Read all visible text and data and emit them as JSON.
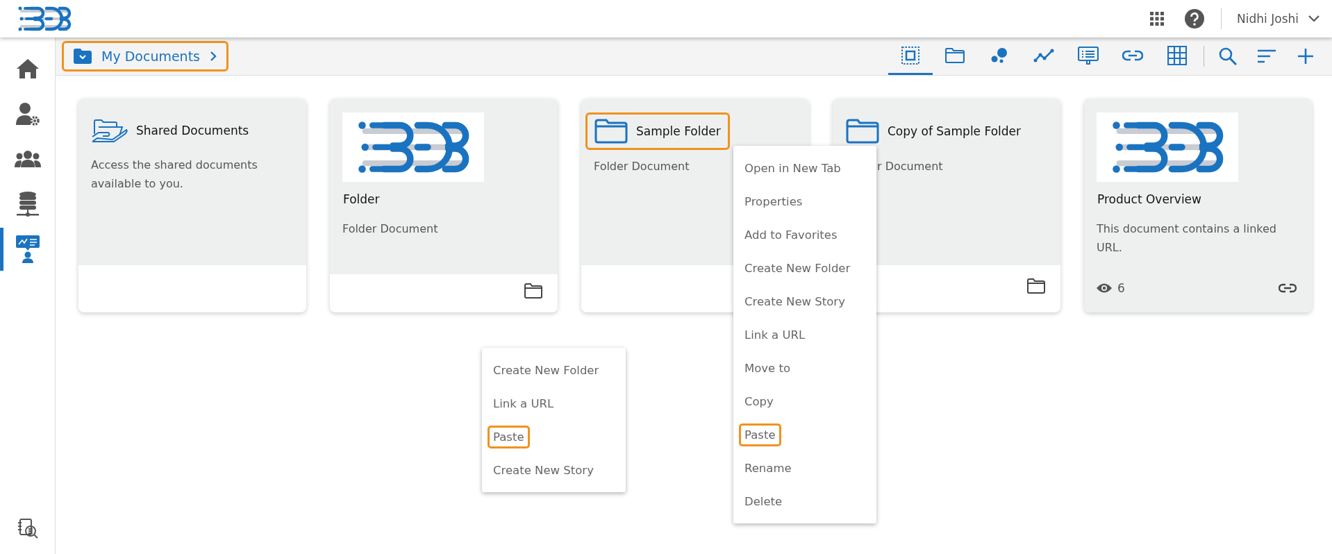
{
  "header": {
    "user_name": "Nidhi Joshi"
  },
  "sidebar": {
    "items": [
      {
        "kind": "home",
        "selected": false
      },
      {
        "kind": "user-settings",
        "selected": false
      },
      {
        "kind": "group",
        "selected": false
      },
      {
        "kind": "database",
        "selected": false
      },
      {
        "kind": "story",
        "selected": true
      }
    ],
    "bottom_item": {
      "kind": "data-search"
    }
  },
  "breadcrumb": {
    "label": "My Documents",
    "highlighted": true
  },
  "view_tabs": [
    {
      "kind": "select",
      "selected": true
    },
    {
      "kind": "folder",
      "selected": false
    },
    {
      "kind": "dots",
      "selected": false
    },
    {
      "kind": "line",
      "selected": false
    },
    {
      "kind": "board",
      "selected": false
    },
    {
      "kind": "link",
      "selected": false
    },
    {
      "kind": "grid",
      "selected": false
    }
  ],
  "actions": [
    {
      "kind": "search"
    },
    {
      "kind": "sort"
    },
    {
      "kind": "add"
    }
  ],
  "cards": [
    {
      "kind": "shared",
      "title": "Shared Documents",
      "title_highlighted": false,
      "description": "Access the shared documents available to you."
    },
    {
      "kind": "image",
      "title": "Folder",
      "title_highlighted": false,
      "description": "Folder Document",
      "footer": {
        "kind": "folder"
      }
    },
    {
      "kind": "folder",
      "title": "Sample Folder",
      "title_highlighted": true,
      "description": "Folder Document"
    },
    {
      "kind": "folder",
      "title": "Copy of Sample Folder",
      "title_highlighted": false,
      "description": "r Document",
      "partly_hidden": true,
      "footer": {
        "kind": "folder"
      }
    },
    {
      "kind": "image",
      "title": "Product Overview",
      "title_highlighted": false,
      "description": "This document contains a linked URL.",
      "views": "6",
      "footer": {
        "kind": "link"
      }
    }
  ],
  "context_menus": [
    {
      "items": [
        {
          "label": "Open in New Tab",
          "highlighted": false
        },
        {
          "label": "Properties",
          "highlighted": false
        },
        {
          "label": "Add to Favorites",
          "highlighted": false
        },
        {
          "label": "Create New Folder",
          "highlighted": false
        },
        {
          "label": "Create New Story",
          "highlighted": false
        },
        {
          "label": "Link a URL",
          "highlighted": false
        },
        {
          "label": "Move to",
          "highlighted": false
        },
        {
          "label": "Copy",
          "highlighted": false
        },
        {
          "label": "Paste",
          "highlighted": true
        },
        {
          "label": "Rename",
          "highlighted": false
        },
        {
          "label": "Delete",
          "highlighted": false
        }
      ]
    },
    {
      "items": [
        {
          "label": "Create New Folder",
          "highlighted": false
        },
        {
          "label": "Link a URL",
          "highlighted": false
        },
        {
          "label": "Paste",
          "highlighted": true
        },
        {
          "label": "Create New Story",
          "highlighted": false
        }
      ]
    }
  ]
}
